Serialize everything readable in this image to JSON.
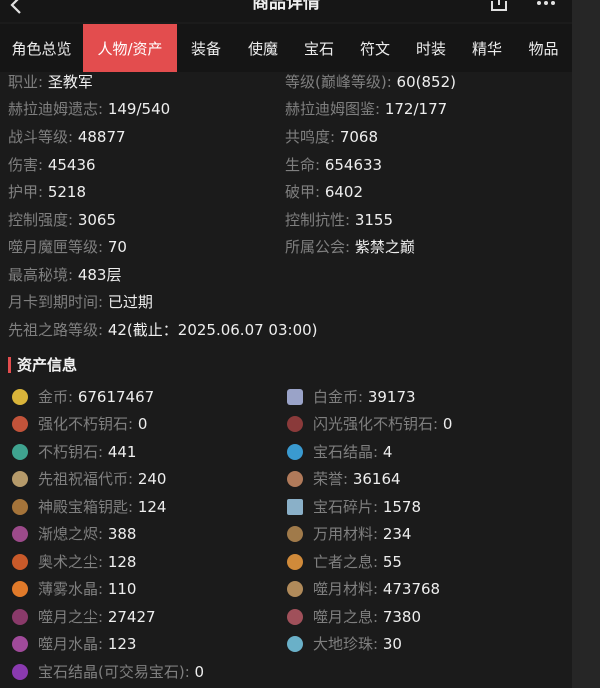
{
  "header": {
    "title": "商品详情"
  },
  "tabs": [
    {
      "label": "角色总览",
      "active": false
    },
    {
      "label": "人物/资产",
      "active": true
    },
    {
      "label": "装备",
      "active": false
    },
    {
      "label": "使魔",
      "active": false
    },
    {
      "label": "宝石",
      "active": false
    },
    {
      "label": "符文",
      "active": false
    },
    {
      "label": "时装",
      "active": false
    },
    {
      "label": "精华",
      "active": false
    },
    {
      "label": "物品",
      "active": false
    }
  ],
  "character": {
    "left": [
      {
        "label": "职业:",
        "value": "圣教军"
      },
      {
        "label": "赫拉迪姆遗志:",
        "value": "149/540"
      },
      {
        "label": "战斗等级:",
        "value": "48877"
      },
      {
        "label": "伤害:",
        "value": "45436"
      },
      {
        "label": "护甲:",
        "value": "5218"
      },
      {
        "label": "控制强度:",
        "value": "3065"
      },
      {
        "label": "噬月魔匣等级:",
        "value": "70"
      },
      {
        "label": "最高秘境:",
        "value": "483层"
      },
      {
        "label": "月卡到期时间:",
        "value": "已过期"
      },
      {
        "label": "先祖之路等级:",
        "value": "42(截止：2025.06.07 03:00)"
      }
    ],
    "right": [
      {
        "label": "等级(巅峰等级):",
        "value": "60(852)"
      },
      {
        "label": "赫拉迪姆图鉴:",
        "value": "172/177"
      },
      {
        "label": "共鸣度:",
        "value": "7068"
      },
      {
        "label": "生命:",
        "value": "654633"
      },
      {
        "label": "破甲:",
        "value": "6402"
      },
      {
        "label": "控制抗性:",
        "value": "3155"
      },
      {
        "label": "所属公会:",
        "value": "紫禁之巅"
      }
    ]
  },
  "assets": {
    "title": "资产信息",
    "left": [
      {
        "label": "金币:",
        "value": "67617467",
        "icon": "gold-coin-icon",
        "color": "#d9b43a"
      },
      {
        "label": "强化不朽钥石:",
        "value": "0",
        "icon": "enhanced-keystone-icon",
        "color": "#c2533a"
      },
      {
        "label": "不朽钥石:",
        "value": "441",
        "icon": "keystone-icon",
        "color": "#3fa38f"
      },
      {
        "label": "先祖祝福代币:",
        "value": "240",
        "icon": "ancestor-token-icon",
        "color": "#b59a6a"
      },
      {
        "label": "神殿宝箱钥匙:",
        "value": "124",
        "icon": "chest-key-icon",
        "color": "#a5743a"
      },
      {
        "label": "渐熄之烬:",
        "value": "388",
        "icon": "ember-icon",
        "color": "#9c4a8a"
      },
      {
        "label": "奥术之尘:",
        "value": "128",
        "icon": "arcane-dust-icon",
        "color": "#c95a2a"
      },
      {
        "label": "薄雾水晶:",
        "value": "110",
        "icon": "mist-crystal-icon",
        "color": "#e07a2a"
      },
      {
        "label": "噬月之尘:",
        "value": "27427",
        "icon": "moon-dust-icon",
        "color": "#8a3a6a"
      },
      {
        "label": "噬月水晶:",
        "value": "123",
        "icon": "moon-crystal-icon",
        "color": "#a04a9a"
      },
      {
        "label": "宝石结晶(可交易宝石):",
        "value": "0",
        "icon": "tradable-gem-crystal-icon",
        "color": "#8a3ab0"
      }
    ],
    "right": [
      {
        "label": "白金币:",
        "value": "39173",
        "icon": "platinum-icon",
        "color": "#9aa3c8"
      },
      {
        "label": "闪光强化不朽钥石:",
        "value": "0",
        "icon": "shining-keystone-icon",
        "color": "#8a3a3a"
      },
      {
        "label": "宝石结晶:",
        "value": "4",
        "icon": "gem-crystal-icon",
        "color": "#3a9ad0"
      },
      {
        "label": "荣誉:",
        "value": "36164",
        "icon": "honor-icon",
        "color": "#b07a5a"
      },
      {
        "label": "宝石碎片:",
        "value": "1578",
        "icon": "gem-shard-icon",
        "color": "#8ab0c8"
      },
      {
        "label": "万用材料:",
        "value": "234",
        "icon": "universal-material-icon",
        "color": "#a07a4a"
      },
      {
        "label": "亡者之息:",
        "value": "55",
        "icon": "dead-breath-icon",
        "color": "#d08a3a"
      },
      {
        "label": "噬月材料:",
        "value": "473768",
        "icon": "moon-material-icon",
        "color": "#b08a5a"
      },
      {
        "label": "噬月之息:",
        "value": "7380",
        "icon": "moon-breath-icon",
        "color": "#a0505a"
      },
      {
        "label": "大地珍珠:",
        "value": "30",
        "icon": "earth-pearl-icon",
        "color": "#6ab0c8"
      }
    ]
  }
}
